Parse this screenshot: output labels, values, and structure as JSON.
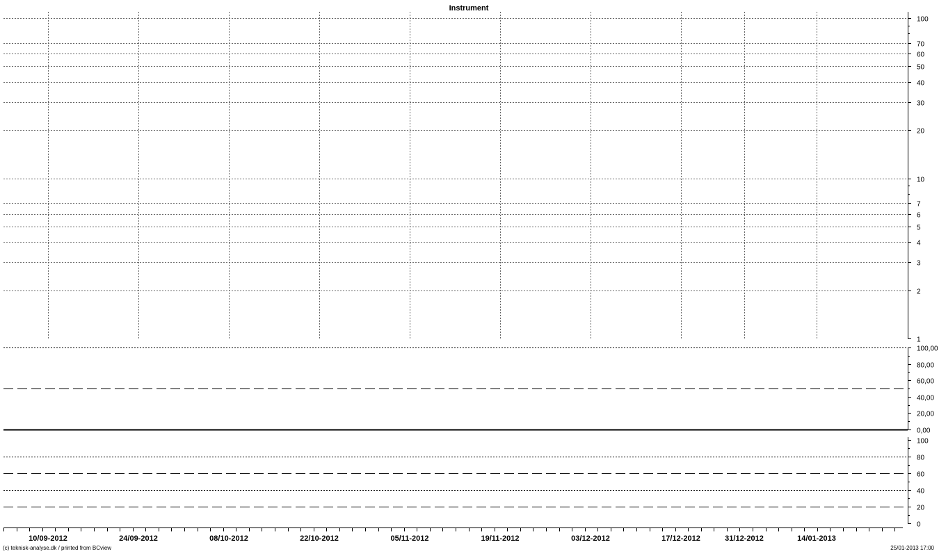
{
  "footer": {
    "left": "(c) teknisk-analyse.dk / printed from BCview",
    "right": "25/01-2013 17:00"
  },
  "chart_data": [
    {
      "type": "line",
      "title": "Instrument",
      "yscale": "log",
      "ylim": [
        1,
        100
      ],
      "ytick_labels": [
        "1",
        "2",
        "3",
        "4",
        "5",
        "6",
        "7",
        "10",
        "20",
        "30",
        "40",
        "50",
        "60",
        "70",
        "100"
      ],
      "grid": true,
      "series": []
    },
    {
      "type": "line",
      "ylim": [
        0,
        100
      ],
      "ytick_labels": [
        "0,00",
        "20,00",
        "40,00",
        "60,00",
        "80,00",
        "100,00"
      ],
      "reference_lines": [
        100,
        50,
        0
      ],
      "series": []
    },
    {
      "type": "line",
      "ylim": [
        0,
        100
      ],
      "ytick_labels": [
        "0",
        "20",
        "40",
        "60",
        "80",
        "100"
      ],
      "reference_lines": [
        80,
        60,
        40,
        20
      ],
      "series": []
    }
  ],
  "x_axis": {
    "labels": [
      "10/09-2012",
      "24/09-2012",
      "08/10-2012",
      "22/10-2012",
      "05/11-2012",
      "19/11-2012",
      "03/12-2012",
      "17/12-2012",
      "31/12-2012",
      "14/01-2013"
    ]
  }
}
